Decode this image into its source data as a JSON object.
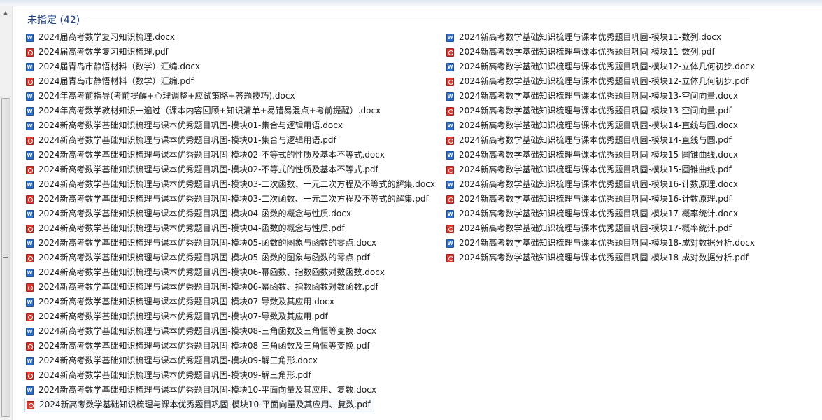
{
  "group": {
    "label": "未指定 (42)"
  },
  "left_items": [
    {
      "name": "2024届高考数学复习知识梳理.docx",
      "type": "docx"
    },
    {
      "name": "2024届高考数学复习知识梳理.pdf",
      "type": "pdf"
    },
    {
      "name": "2024届青岛市静悟材料（数学）汇编.docx",
      "type": "docx"
    },
    {
      "name": "2024届青岛市静悟材料（数学）汇编.pdf",
      "type": "pdf"
    },
    {
      "name": "2024年高考前指导(考前提醒+心理调整+应试策略+答题技巧).docx",
      "type": "docx"
    },
    {
      "name": "2024年高考数学教材知识一遍过（课本内容回顾+知识清单+易错易混点+考前提醒）.docx",
      "type": "docx"
    },
    {
      "name": "2024新高考数学基础知识梳理与课本优秀题目巩固-模块01-集合与逻辑用语.docx",
      "type": "docx"
    },
    {
      "name": "2024新高考数学基础知识梳理与课本优秀题目巩固-模块01-集合与逻辑用语.pdf",
      "type": "pdf"
    },
    {
      "name": "2024新高考数学基础知识梳理与课本优秀题目巩固-模块02-不等式的性质及基本不等式.docx",
      "type": "docx"
    },
    {
      "name": "2024新高考数学基础知识梳理与课本优秀题目巩固-模块02-不等式的性质及基本不等式.pdf",
      "type": "pdf"
    },
    {
      "name": "2024新高考数学基础知识梳理与课本优秀题目巩固-模块03-二次函数、一元二次方程及不等式的解集.docx",
      "type": "docx"
    },
    {
      "name": "2024新高考数学基础知识梳理与课本优秀题目巩固-模块03-二次函数、一元二次方程及不等式的解集.pdf",
      "type": "pdf"
    },
    {
      "name": "2024新高考数学基础知识梳理与课本优秀题目巩固-模块04-函数的概念与性质.docx",
      "type": "docx"
    },
    {
      "name": "2024新高考数学基础知识梳理与课本优秀题目巩固-模块04-函数的概念与性质.pdf",
      "type": "pdf"
    },
    {
      "name": "2024新高考数学基础知识梳理与课本优秀题目巩固-模块05-函数的图象与函数的零点.docx",
      "type": "docx"
    },
    {
      "name": "2024新高考数学基础知识梳理与课本优秀题目巩固-模块05-函数的图象与函数的零点.pdf",
      "type": "pdf"
    },
    {
      "name": "2024新高考数学基础知识梳理与课本优秀题目巩固-模块06-幂函数、指数函数对数函数.docx",
      "type": "docx"
    },
    {
      "name": "2024新高考数学基础知识梳理与课本优秀题目巩固-模块06-幂函数、指数函数对数函数.pdf",
      "type": "pdf"
    },
    {
      "name": "2024新高考数学基础知识梳理与课本优秀题目巩固-模块07-导数及其应用.docx",
      "type": "docx"
    },
    {
      "name": "2024新高考数学基础知识梳理与课本优秀题目巩固-模块07-导数及其应用.pdf",
      "type": "pdf"
    },
    {
      "name": "2024新高考数学基础知识梳理与课本优秀题目巩固-模块08-三角函数及三角恒等变换.docx",
      "type": "docx"
    },
    {
      "name": "2024新高考数学基础知识梳理与课本优秀题目巩固-模块08-三角函数及三角恒等变换.pdf",
      "type": "pdf"
    },
    {
      "name": "2024新高考数学基础知识梳理与课本优秀题目巩固-模块09-解三角形.docx",
      "type": "docx"
    },
    {
      "name": "2024新高考数学基础知识梳理与课本优秀题目巩固-模块09-解三角形.pdf",
      "type": "pdf"
    },
    {
      "name": "2024新高考数学基础知识梳理与课本优秀题目巩固-模块10-平面向量及其应用、复数.docx",
      "type": "docx"
    },
    {
      "name": "2024新高考数学基础知识梳理与课本优秀题目巩固-模块10-平面向量及其应用、复数.pdf",
      "type": "pdf"
    }
  ],
  "right_items": [
    {
      "name": "2024新高考数学基础知识梳理与课本优秀题目巩固-模块11-数列.docx",
      "type": "docx"
    },
    {
      "name": "2024新高考数学基础知识梳理与课本优秀题目巩固-模块11-数列.pdf",
      "type": "pdf"
    },
    {
      "name": "2024新高考数学基础知识梳理与课本优秀题目巩固-模块12-立体几何初步.docx",
      "type": "docx"
    },
    {
      "name": "2024新高考数学基础知识梳理与课本优秀题目巩固-模块12-立体几何初步.pdf",
      "type": "pdf"
    },
    {
      "name": "2024新高考数学基础知识梳理与课本优秀题目巩固-模块13-空间向量.docx",
      "type": "docx"
    },
    {
      "name": "2024新高考数学基础知识梳理与课本优秀题目巩固-模块13-空间向量.pdf",
      "type": "pdf"
    },
    {
      "name": "2024新高考数学基础知识梳理与课本优秀题目巩固-模块14-直线与圆.docx",
      "type": "docx"
    },
    {
      "name": "2024新高考数学基础知识梳理与课本优秀题目巩固-模块14-直线与圆.pdf",
      "type": "pdf"
    },
    {
      "name": "2024新高考数学基础知识梳理与课本优秀题目巩固-模块15-圆锥曲线.docx",
      "type": "docx"
    },
    {
      "name": "2024新高考数学基础知识梳理与课本优秀题目巩固-模块15-圆锥曲线.pdf",
      "type": "pdf"
    },
    {
      "name": "2024新高考数学基础知识梳理与课本优秀题目巩固-模块16-计数原理.docx",
      "type": "docx"
    },
    {
      "name": "2024新高考数学基础知识梳理与课本优秀题目巩固-模块16-计数原理.pdf",
      "type": "pdf"
    },
    {
      "name": "2024新高考数学基础知识梳理与课本优秀题目巩固-模块17-概率统计.docx",
      "type": "docx"
    },
    {
      "name": "2024新高考数学基础知识梳理与课本优秀题目巩固-模块17-概率统计.pdf",
      "type": "pdf"
    },
    {
      "name": "2024新高考数学基础知识梳理与课本优秀题目巩固-模块18-成对数据分析.docx",
      "type": "docx"
    },
    {
      "name": "2024新高考数学基础知识梳理与课本优秀题目巩固-模块18-成对数据分析.pdf",
      "type": "pdf"
    }
  ],
  "icons": {
    "docx": "word-document-icon",
    "pdf": "pdf-document-icon"
  },
  "colors": {
    "group_header": "#1e3f8a",
    "docx_icon": "#2f6fc9",
    "pdf_icon": "#d83a32"
  }
}
